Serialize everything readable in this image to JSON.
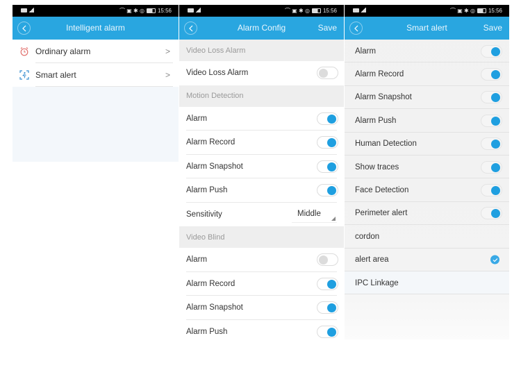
{
  "status_bar": {
    "time": "15:56"
  },
  "colors": {
    "header_blue": "#29a6e0",
    "toggle_on": "#1f9fe0",
    "toggle_off": "#dcdcdc",
    "check_blue": "#39a9e6"
  },
  "screen1": {
    "title": "Intelligent alarm",
    "items": [
      {
        "label": "Ordinary alarm",
        "icon": "alarm-clock-icon"
      },
      {
        "label": "Smart alert",
        "icon": "smart-detection-icon"
      }
    ]
  },
  "screen2": {
    "title": "Alarm Config",
    "save_label": "Save",
    "sections": [
      {
        "header": "Video Loss Alarm",
        "rows": [
          {
            "label": "Video Loss Alarm",
            "type": "toggle",
            "on": false
          }
        ]
      },
      {
        "header": "Motion Detection",
        "rows": [
          {
            "label": "Alarm",
            "type": "toggle",
            "on": true
          },
          {
            "label": "Alarm Record",
            "type": "toggle",
            "on": true
          },
          {
            "label": "Alarm Snapshot",
            "type": "toggle",
            "on": true
          },
          {
            "label": "Alarm Push",
            "type": "toggle",
            "on": true
          },
          {
            "label": "Sensitivity",
            "type": "select",
            "value": "Middle"
          }
        ]
      },
      {
        "header": "Video Blind",
        "rows": [
          {
            "label": "Alarm",
            "type": "toggle",
            "on": false
          },
          {
            "label": "Alarm Record",
            "type": "toggle",
            "on": true
          },
          {
            "label": "Alarm Snapshot",
            "type": "toggle",
            "on": true
          },
          {
            "label": "Alarm Push",
            "type": "toggle",
            "on": true
          }
        ]
      }
    ]
  },
  "screen3": {
    "title": "Smart alert",
    "save_label": "Save",
    "rows": [
      {
        "label": "Alarm",
        "type": "toggle",
        "on": true
      },
      {
        "label": "Alarm Record",
        "type": "toggle",
        "on": true
      },
      {
        "label": "Alarm Snapshot",
        "type": "toggle",
        "on": true
      },
      {
        "label": "Alarm Push",
        "type": "toggle",
        "on": true
      },
      {
        "label": "Human Detection",
        "type": "toggle",
        "on": true
      },
      {
        "label": "Show traces",
        "type": "toggle",
        "on": true
      },
      {
        "label": "Face Detection",
        "type": "toggle",
        "on": true
      },
      {
        "label": "Perimeter alert",
        "type": "toggle",
        "on": true
      },
      {
        "label": "cordon",
        "type": "option",
        "checked": false
      },
      {
        "label": "alert area",
        "type": "option",
        "checked": true
      },
      {
        "label": "IPC Linkage",
        "type": "link"
      }
    ]
  }
}
